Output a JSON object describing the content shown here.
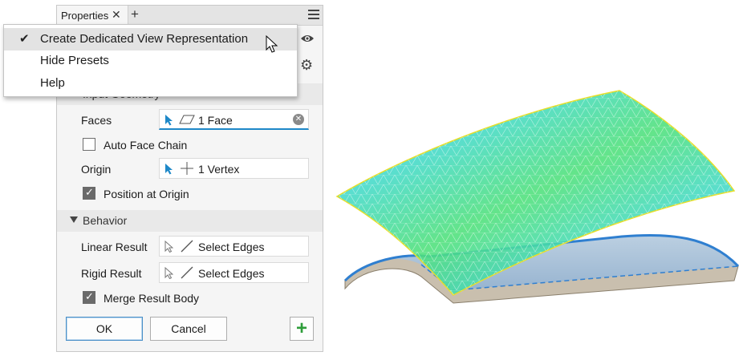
{
  "panel": {
    "tab_title": "Properties",
    "tab_close_glyph": "✕",
    "tab_add_glyph": "+",
    "menu_icon": "hamburger-menu-icon",
    "side_icons": [
      "eye-icon",
      "gear-icon"
    ]
  },
  "dropdown": {
    "items": [
      {
        "label": "Create Dedicated View Representation",
        "checked": true,
        "highlighted": true
      },
      {
        "label": "Hide Presets",
        "checked": false
      },
      {
        "label": "Help",
        "checked": false
      }
    ]
  },
  "input_geometry": {
    "header": "Input Geometry",
    "faces": {
      "label": "Faces",
      "value": "1 Face"
    },
    "auto_face_chain": {
      "label": "Auto Face Chain",
      "checked": false
    },
    "origin": {
      "label": "Origin",
      "value": "1 Vertex"
    },
    "position_at_origin": {
      "label": "Position at Origin",
      "checked": true
    }
  },
  "behavior": {
    "header": "Behavior",
    "linear_result": {
      "label": "Linear Result",
      "value": "Select Edges"
    },
    "rigid_result": {
      "label": "Rigid Result",
      "value": "Select Edges"
    },
    "merge_result_body": {
      "label": "Merge Result Body",
      "checked": true
    }
  },
  "buttons": {
    "ok": "OK",
    "cancel": "Cancel",
    "add": "+"
  },
  "colors": {
    "accent_blue": "#1e88c8",
    "add_green": "#2e9d3a",
    "mesh_cyan": "#33d6e8",
    "mesh_green": "#4ee07a",
    "mesh_orange": "#e0a050",
    "body_blue": "#2f7fd0"
  }
}
